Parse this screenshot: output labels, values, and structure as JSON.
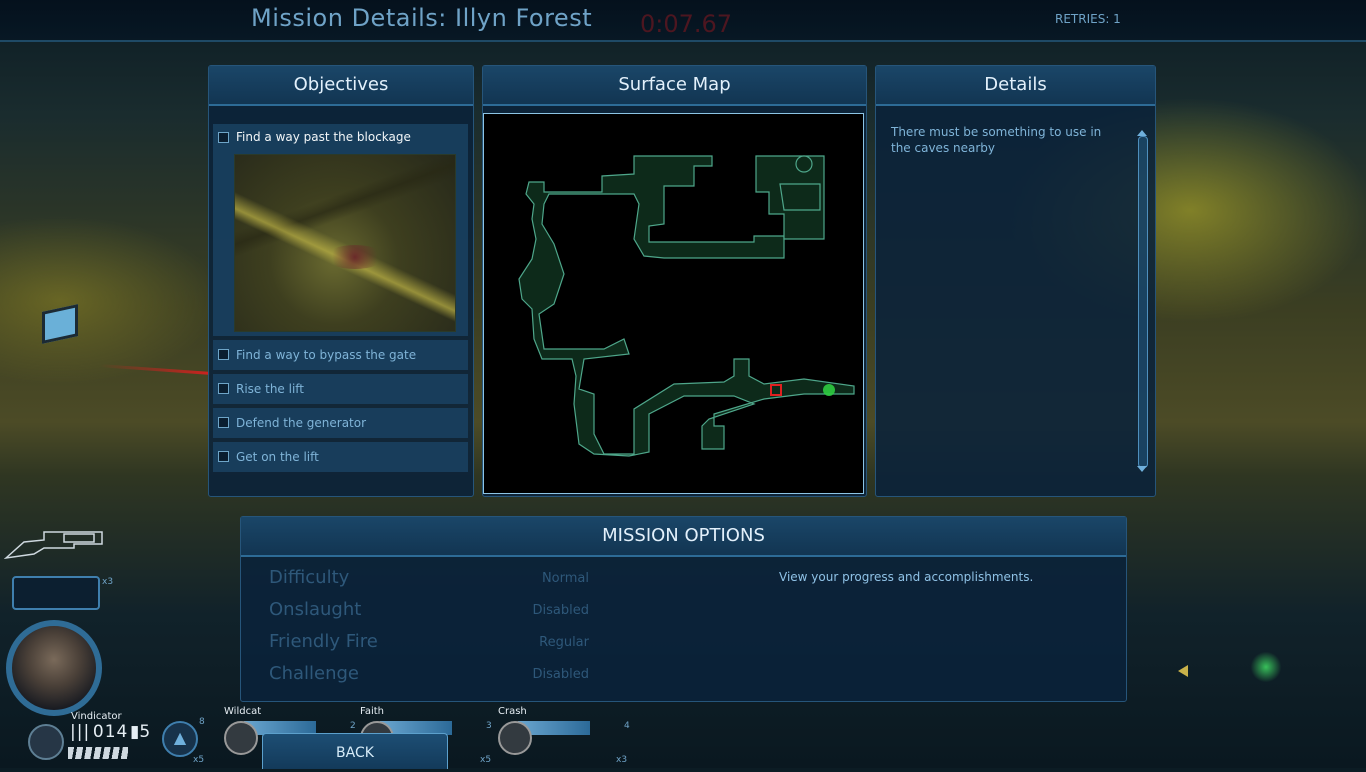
{
  "header": {
    "title": "Mission Details: Illyn Forest",
    "timer": "0:07.67",
    "retries": "RETRIES: 1"
  },
  "objectives": {
    "heading": "Objectives",
    "items": [
      {
        "label": "Find a way past the blockage",
        "active": true
      },
      {
        "label": "Find a way to bypass the gate",
        "active": false
      },
      {
        "label": "Rise the lift",
        "active": false
      },
      {
        "label": "Defend the generator",
        "active": false
      },
      {
        "label": "Get on the lift",
        "active": false
      }
    ]
  },
  "surface_map": {
    "heading": "Surface Map",
    "player_marker_color": "#e02020",
    "objective_marker_color": "#2ecc40"
  },
  "details": {
    "heading": "Details",
    "text": "There must be something to use in the caves nearby"
  },
  "mission_options": {
    "heading": "MISSION OPTIONS",
    "description": "View your progress and accomplishments.",
    "options": [
      {
        "name": "Difficulty",
        "value": "Normal"
      },
      {
        "name": "Onslaught",
        "value": "Disabled"
      },
      {
        "name": "Friendly Fire",
        "value": "Regular"
      },
      {
        "name": "Challenge",
        "value": "Disabled"
      }
    ]
  },
  "hud": {
    "player_name": "Vindicator",
    "ammo_counter": "014",
    "grenades": "5",
    "ammo_box_multiplier": "x3",
    "ability_count": "8",
    "ability_multiplier": "x5",
    "squad": [
      {
        "name": "Wildcat",
        "number": ""
      },
      {
        "name": "Faith",
        "number": "2"
      },
      {
        "name": "Crash",
        "number": "3"
      }
    ],
    "squad_extra_number": "4",
    "squad_multiplier_a": "x5",
    "squad_multiplier_b": "x3"
  },
  "footer": {
    "back_label": "BACK"
  }
}
